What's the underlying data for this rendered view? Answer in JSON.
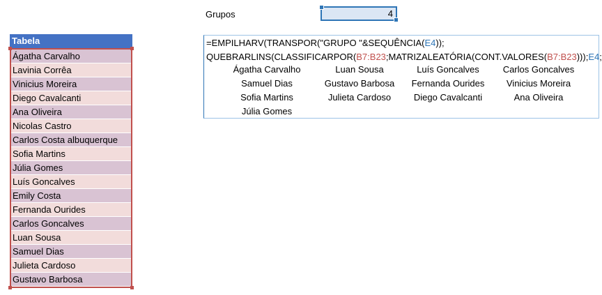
{
  "grupos": {
    "label": "Grupos",
    "value": "4"
  },
  "tabela": {
    "header": "Tabela",
    "rows": [
      "Ágatha Carvalho",
      "Lavinia Corrêa",
      "Vinicius Moreira",
      "Diego Cavalcanti",
      "Ana Oliveira",
      "Nicolas Castro",
      "Carlos Costa albuquerque",
      "Sofia Martins",
      "Júlia Gomes",
      "Luís Goncalves",
      "Emily Costa",
      "Fernanda Ourides",
      "Carlos Goncalves",
      "Luan Sousa",
      "Samuel Dias",
      "Julieta Cardoso",
      "Gustavo Barbosa"
    ]
  },
  "formula": {
    "line1_a": "=EMPILHARV(TRANSPOR(\"GRUPO \"&SEQUÊNCIA(",
    "line1_ref": "E4",
    "line1_b": "));",
    "line2_a": "QUEBRARLINS(CLASSIFICARPOR(",
    "line2_ref1": "B7:B23",
    "line2_b": ";MATRIZALEATÓRIA(CONT.VALORES(",
    "line2_ref2": "B7:B23",
    "line2_c": ")));",
    "line2_ref3": "E4",
    "line2_d": ";\"\"))"
  },
  "results": [
    [
      "Ágatha Carvalho",
      "Luan Sousa",
      "Luís Goncalves",
      "Carlos Goncalves"
    ],
    [
      "Samuel Dias",
      "Gustavo Barbosa",
      "Fernanda Ourides",
      "Vinicius Moreira"
    ],
    [
      "Sofia Martins",
      "Julieta Cardoso",
      "Diego Cavalcanti",
      "Ana Oliveira"
    ],
    [
      "Júlia Gomes",
      "",
      "",
      ""
    ]
  ],
  "colors": {
    "header_blue": "#4472c4",
    "row_odd": "#d9c3d3",
    "row_even": "#f2dcdb",
    "table_border": "#c0504d",
    "ref_red": "#c0504d",
    "ref_blue": "#2e75b6"
  }
}
